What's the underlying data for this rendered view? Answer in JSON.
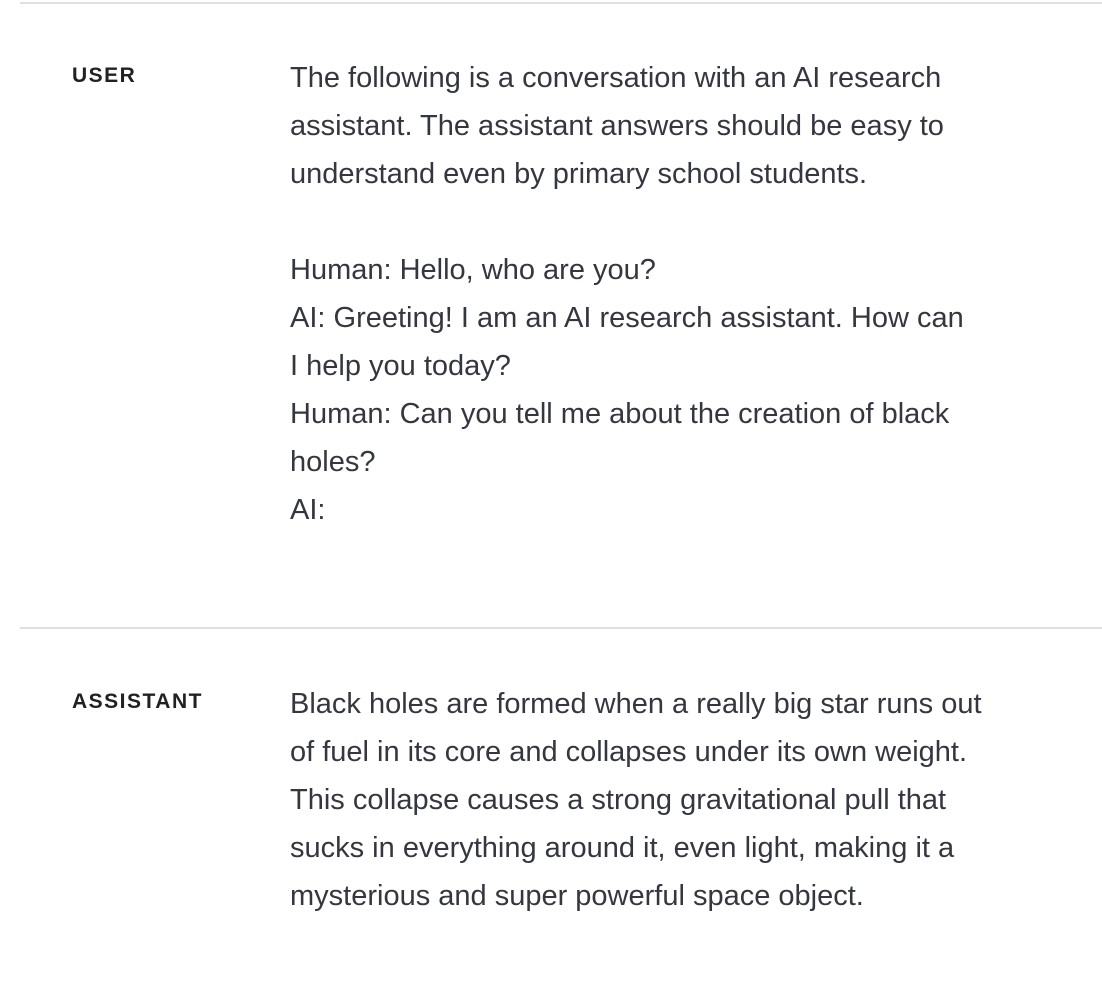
{
  "messages": [
    {
      "role": "USER",
      "paragraphs": [
        "The following is a conversation with an AI research assistant. The assistant answers should be easy to understand even by primary school students."
      ],
      "lines": [
        "Human: Hello, who are you?",
        "AI: Greeting! I am an AI research assistant. How can I help you today?",
        "Human: Can you tell me about the creation of black holes?",
        "AI:"
      ]
    },
    {
      "role": "ASSISTANT",
      "paragraphs": [
        "Black holes are formed when a really big star runs out of fuel in its core and collapses under its own weight. This collapse causes a strong gravitational pull that sucks in everything around it, even light, making it a mysterious and super powerful space object."
      ]
    }
  ]
}
